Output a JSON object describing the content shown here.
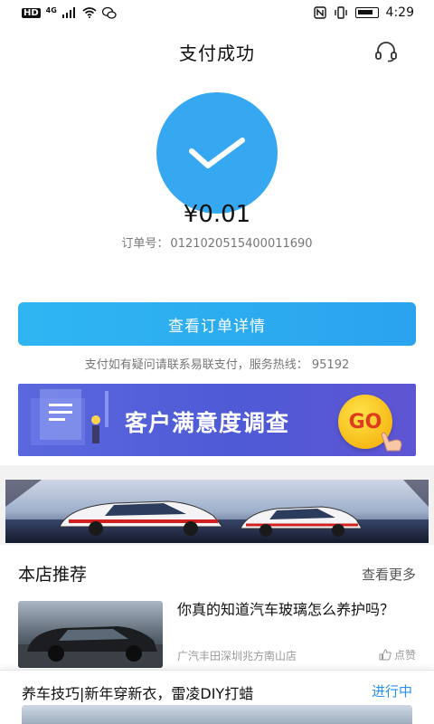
{
  "status_bar": {
    "left_labels": [
      "HD",
      "4G"
    ],
    "time": "4:29"
  },
  "header": {
    "title": "支付成功",
    "service_icon": "headset-icon"
  },
  "payment": {
    "status_icon": "check-icon",
    "amount": "¥0.01",
    "order_label": "订单号：",
    "order_number": "0121020515400011690",
    "detail_button": "查看订单详情",
    "hotline_text": "支付如有疑问请联系易联支付，服务热线： 95192"
  },
  "banner": {
    "survey_text": "客户满意度调查",
    "go_text": "GO"
  },
  "recommend": {
    "title": "本店推荐",
    "more_label": "查看更多",
    "article": {
      "title": "你真的知道汽车玻璃怎么养护吗？",
      "shop": "广汽丰田深圳兆方南山店",
      "like_label": "点赞"
    }
  },
  "bottom_card": {
    "title": "养车技巧|新年穿新衣，雷凌DIY打蜡",
    "status": "进行中"
  },
  "colors": {
    "accent_blue": "#35a8f1",
    "button_blue": "#2aa3ee",
    "link_blue": "#2a8ff0",
    "survey_purple": "#5a68dd"
  }
}
